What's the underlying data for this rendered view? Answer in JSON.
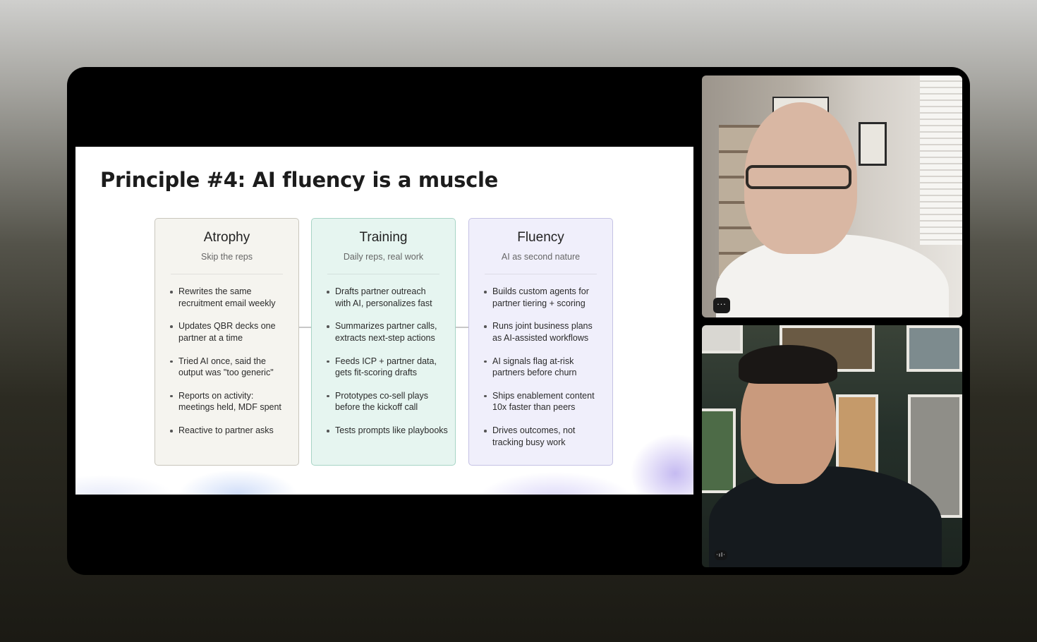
{
  "slide": {
    "title": "Principle #4: AI fluency is a muscle",
    "columns": [
      {
        "title": "Atrophy",
        "subtitle": "Skip the reps",
        "bg_color": "#f5f4ef",
        "border_color": "#c9c6bd",
        "items": [
          [
            "Rewrites the same",
            "recruitment email weekly"
          ],
          [
            "Updates QBR decks one",
            "partner at a time"
          ],
          [
            "Tried AI once, said the",
            "output was \"too generic\""
          ],
          [
            "Reports on activity:",
            "meetings held, MDF spent"
          ],
          [
            "Reactive to partner asks"
          ]
        ]
      },
      {
        "title": "Training",
        "subtitle": "Daily reps, real work",
        "bg_color": "#e6f5f0",
        "border_color": "#a8d4c6",
        "items": [
          [
            "Drafts partner outreach",
            "with AI, personalizes fast"
          ],
          [
            "Summarizes partner calls,",
            "extracts next-step actions"
          ],
          [
            "Feeds ICP + partner data,",
            "gets fit-scoring drafts"
          ],
          [
            "Prototypes co-sell plays",
            "before the kickoff call"
          ],
          [
            "Tests prompts like playbooks"
          ]
        ]
      },
      {
        "title": "Fluency",
        "subtitle": "AI as second nature",
        "bg_color": "#f0effb",
        "border_color": "#c5c2e4",
        "items": [
          [
            "Builds custom agents for",
            "partner tiering + scoring"
          ],
          [
            "Runs joint business plans",
            "as AI-assisted workflows"
          ],
          [
            "AI signals flag at-risk",
            "partners before churn"
          ],
          [
            "Ships enablement content",
            "10x faster than peers"
          ],
          [
            "Drives outcomes, not",
            "tracking busy work"
          ]
        ]
      }
    ]
  },
  "participants": [
    {
      "icon": "more-options-icon",
      "badge": "···"
    },
    {
      "icon": "audio-level-icon",
      "badge": "·ıl·"
    }
  ]
}
